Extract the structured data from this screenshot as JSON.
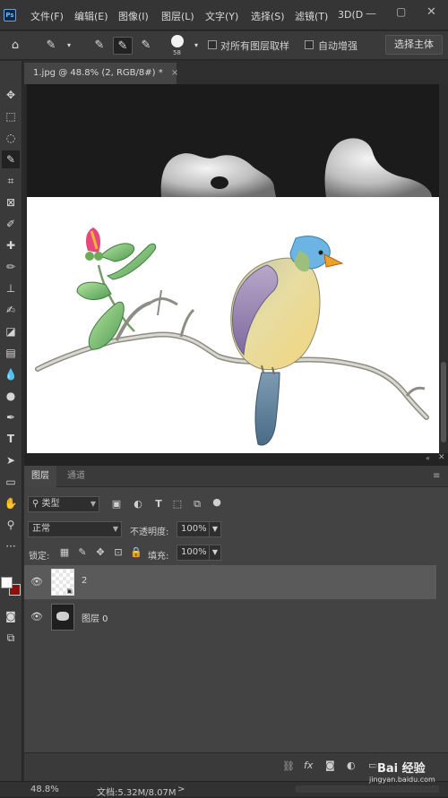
{
  "app": {
    "logo": "Ps"
  },
  "menu": [
    "文件(F)",
    "编辑(E)",
    "图像(I)",
    "图层(L)",
    "文字(Y)",
    "选择(S)",
    "滤镜(T)",
    "3D(D"
  ],
  "options": {
    "brush_size": "58",
    "sample_all_layers_label": "对所有图层取样",
    "auto_enhance_label": "自动增强",
    "select_subject_label": "选择主体"
  },
  "document": {
    "tab_title": "1.jpg @ 48.8% (2, RGB/8#) *",
    "close_symbol": "×"
  },
  "layers_panel": {
    "tabs": [
      "图层",
      "通道"
    ],
    "filter_kind": "类型",
    "blend_mode": "正常",
    "opacity_label": "不透明度:",
    "opacity_value": "100%",
    "lock_label": "锁定:",
    "fill_label": "填充:",
    "fill_value": "100%",
    "layers": [
      {
        "name": "2",
        "visible": true,
        "selected": true
      },
      {
        "name": "图层 0",
        "visible": true,
        "selected": false
      }
    ],
    "bottom_icons": [
      "link-icon",
      "fx-icon",
      "mask-icon",
      "adjustment-icon",
      "group-icon",
      "new-layer-icon",
      "trash-icon"
    ]
  },
  "status": {
    "zoom": "48.8%",
    "doc_size": "文档:5.32M/8.07M",
    "arrow": ">"
  },
  "watermark": {
    "text": "Bai 经验",
    "url": "jingyan.baidu.com"
  },
  "colors": {
    "foreground": "#ffffff",
    "background": "#8b0f0f",
    "accent": "#6fb7ff"
  }
}
